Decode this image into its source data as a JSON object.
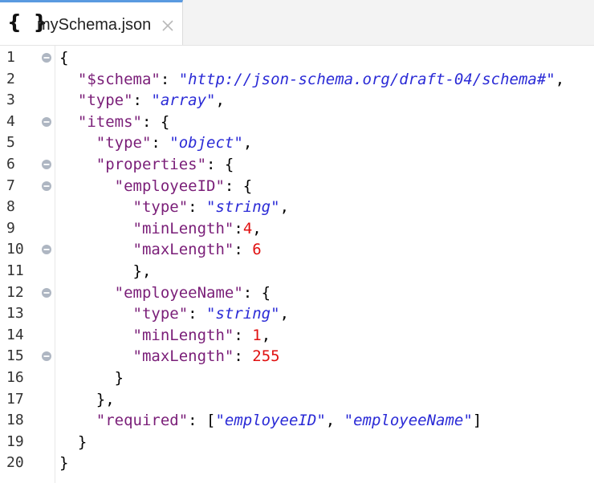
{
  "tab": {
    "icon_text": "{ }",
    "file_name": "mySchema.json",
    "close_icon": "close-icon"
  },
  "lines": [
    {
      "n": "1",
      "fold": true,
      "code": [
        {
          "t": "p",
          "v": "{"
        }
      ]
    },
    {
      "n": "2",
      "fold": false,
      "code": [
        {
          "t": "p",
          "v": "  "
        },
        {
          "t": "k",
          "v": "\"$schema\""
        },
        {
          "t": "p",
          "v": ": "
        },
        {
          "t": "s",
          "v": "\"http://json-schema.org/draft-04/schema#\""
        },
        {
          "t": "p",
          "v": ","
        }
      ]
    },
    {
      "n": "3",
      "fold": false,
      "code": [
        {
          "t": "p",
          "v": "  "
        },
        {
          "t": "k",
          "v": "\"type\""
        },
        {
          "t": "p",
          "v": ": "
        },
        {
          "t": "s",
          "v": "\"array\""
        },
        {
          "t": "p",
          "v": ","
        }
      ]
    },
    {
      "n": "4",
      "fold": true,
      "code": [
        {
          "t": "p",
          "v": "  "
        },
        {
          "t": "k",
          "v": "\"items\""
        },
        {
          "t": "p",
          "v": ": {"
        }
      ]
    },
    {
      "n": "5",
      "fold": false,
      "code": [
        {
          "t": "p",
          "v": "    "
        },
        {
          "t": "k",
          "v": "\"type\""
        },
        {
          "t": "p",
          "v": ": "
        },
        {
          "t": "s",
          "v": "\"object\""
        },
        {
          "t": "p",
          "v": ","
        }
      ]
    },
    {
      "n": "6",
      "fold": true,
      "code": [
        {
          "t": "p",
          "v": "    "
        },
        {
          "t": "k",
          "v": "\"properties\""
        },
        {
          "t": "p",
          "v": ": {"
        }
      ]
    },
    {
      "n": "7",
      "fold": true,
      "code": [
        {
          "t": "p",
          "v": "      "
        },
        {
          "t": "k",
          "v": "\"employeeID\""
        },
        {
          "t": "p",
          "v": ": {"
        }
      ]
    },
    {
      "n": "8",
      "fold": false,
      "code": [
        {
          "t": "p",
          "v": "        "
        },
        {
          "t": "k",
          "v": "\"type\""
        },
        {
          "t": "p",
          "v": ": "
        },
        {
          "t": "s",
          "v": "\"string\""
        },
        {
          "t": "p",
          "v": ","
        }
      ]
    },
    {
      "n": "9",
      "fold": false,
      "code": [
        {
          "t": "p",
          "v": "        "
        },
        {
          "t": "k",
          "v": "\"minLength\""
        },
        {
          "t": "p",
          "v": ":"
        },
        {
          "t": "n",
          "v": "4"
        },
        {
          "t": "p",
          "v": ","
        }
      ]
    },
    {
      "n": "10",
      "fold": true,
      "code": [
        {
          "t": "p",
          "v": "        "
        },
        {
          "t": "k",
          "v": "\"maxLength\""
        },
        {
          "t": "p",
          "v": ": "
        },
        {
          "t": "n",
          "v": "6"
        }
      ]
    },
    {
      "n": "11",
      "fold": false,
      "code": [
        {
          "t": "p",
          "v": "        },"
        }
      ]
    },
    {
      "n": "12",
      "fold": true,
      "code": [
        {
          "t": "p",
          "v": "      "
        },
        {
          "t": "k",
          "v": "\"employeeName\""
        },
        {
          "t": "p",
          "v": ": {"
        }
      ]
    },
    {
      "n": "13",
      "fold": false,
      "code": [
        {
          "t": "p",
          "v": "        "
        },
        {
          "t": "k",
          "v": "\"type\""
        },
        {
          "t": "p",
          "v": ": "
        },
        {
          "t": "s",
          "v": "\"string\""
        },
        {
          "t": "p",
          "v": ","
        }
      ]
    },
    {
      "n": "14",
      "fold": false,
      "code": [
        {
          "t": "p",
          "v": "        "
        },
        {
          "t": "k",
          "v": "\"minLength\""
        },
        {
          "t": "p",
          "v": ": "
        },
        {
          "t": "n",
          "v": "1"
        },
        {
          "t": "p",
          "v": ","
        }
      ]
    },
    {
      "n": "15",
      "fold": true,
      "code": [
        {
          "t": "p",
          "v": "        "
        },
        {
          "t": "k",
          "v": "\"maxLength\""
        },
        {
          "t": "p",
          "v": ": "
        },
        {
          "t": "n",
          "v": "255"
        }
      ]
    },
    {
      "n": "16",
      "fold": false,
      "code": [
        {
          "t": "p",
          "v": "      }"
        }
      ]
    },
    {
      "n": "17",
      "fold": false,
      "code": [
        {
          "t": "p",
          "v": "    },"
        }
      ]
    },
    {
      "n": "18",
      "fold": false,
      "code": [
        {
          "t": "p",
          "v": "    "
        },
        {
          "t": "k",
          "v": "\"required\""
        },
        {
          "t": "p",
          "v": ": ["
        },
        {
          "t": "s",
          "v": "\"employeeID\""
        },
        {
          "t": "p",
          "v": ", "
        },
        {
          "t": "s",
          "v": "\"employeeName\""
        },
        {
          "t": "p",
          "v": "]"
        }
      ]
    },
    {
      "n": "19",
      "fold": false,
      "code": [
        {
          "t": "p",
          "v": "  }"
        }
      ]
    },
    {
      "n": "20",
      "fold": false,
      "code": [
        {
          "t": "p",
          "v": "}"
        }
      ]
    }
  ],
  "colors": {
    "key": "#7a1e78",
    "string": "#2a2ad6",
    "number": "#e01010",
    "tab_accent": "#5a9ae0"
  }
}
